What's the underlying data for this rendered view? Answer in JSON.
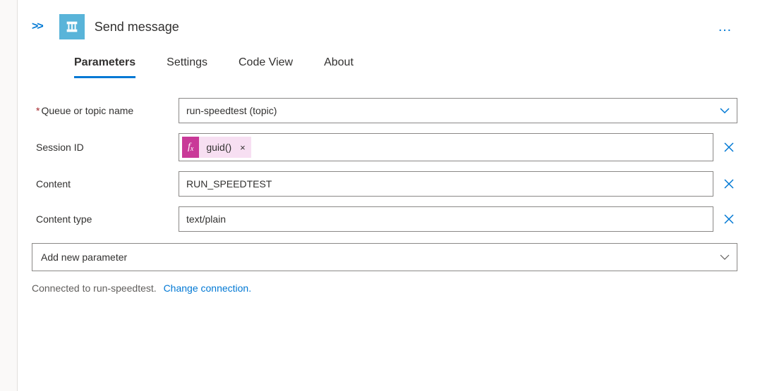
{
  "header": {
    "expand_glyph": ">>",
    "title": "Send message",
    "more_glyph": "…"
  },
  "tabs": [
    {
      "label": "Parameters",
      "active": true
    },
    {
      "label": "Settings",
      "active": false
    },
    {
      "label": "Code View",
      "active": false
    },
    {
      "label": "About",
      "active": false
    }
  ],
  "fields": {
    "queue": {
      "label": "Queue or topic name",
      "value": "run-speedtest (topic)"
    },
    "session_id": {
      "label": "Session ID",
      "token": {
        "fx_label": "f",
        "fx_sub": "x",
        "expr": "guid()",
        "remove": "×"
      }
    },
    "content": {
      "label": "Content",
      "value": "RUN_SPEEDTEST"
    },
    "content_type": {
      "label": "Content type",
      "value": "text/plain"
    }
  },
  "add_param": {
    "label": "Add new parameter"
  },
  "connection": {
    "status_prefix": "Connected to ",
    "name": "run-speedtest.",
    "change_link": "Change connection."
  }
}
